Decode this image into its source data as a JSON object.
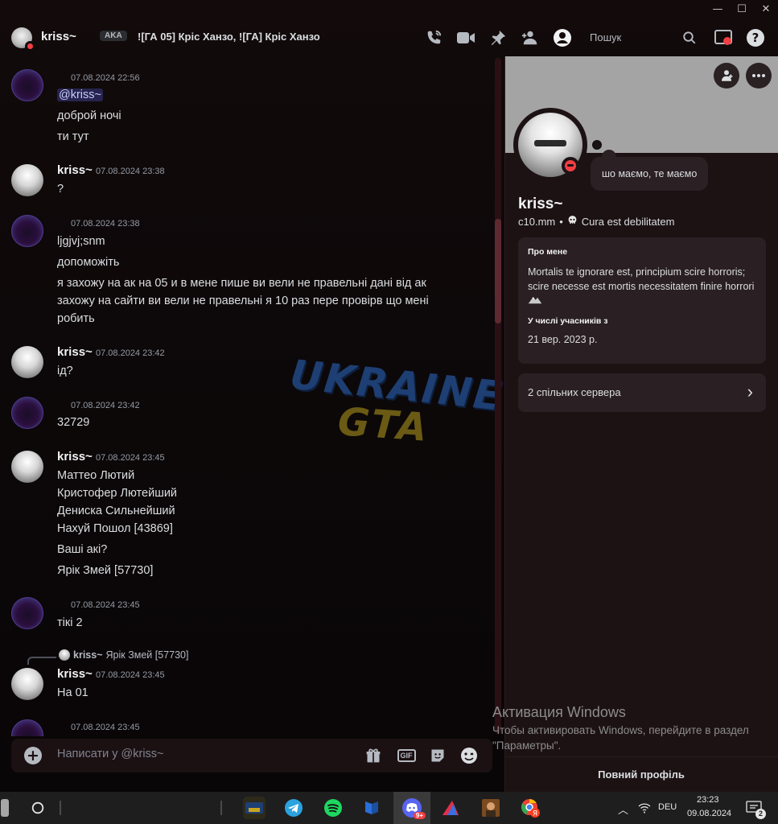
{
  "window": {
    "minimize": "—",
    "maximize": "☐",
    "close": "✕"
  },
  "header": {
    "name": "kriss~",
    "aka_label": "AKA",
    "nicknames": "![ГА 05] Кріс Ханзо, ![ГА] Кріс Ханзо",
    "search_placeholder": "Пошук"
  },
  "messages": [
    {
      "author": "",
      "time": "07.08.2024 22:56",
      "lines": [
        "@kriss~",
        "доброй ночі",
        "ти тут"
      ]
    },
    {
      "author": "kriss~",
      "time": "07.08.2024 23:38",
      "lines": [
        "?"
      ]
    },
    {
      "author": "",
      "time": "07.08.2024 23:38",
      "lines": [
        "ljgjvj;snm",
        "допоможіть",
        "я захожу на ак на 05 и в мене пише ви вели не правельні дані від ак",
        "захожу на сайти ви вели не правельні  я 10 раз пере провірв  що мені",
        "робить"
      ]
    },
    {
      "author": "kriss~",
      "time": "07.08.2024 23:42",
      "lines": [
        "ід?"
      ]
    },
    {
      "author": "",
      "time": "07.08.2024 23:42",
      "lines": [
        "32729"
      ]
    },
    {
      "author": "kriss~",
      "time": "07.08.2024 23:45",
      "lines": [
        "Маттео Лютий",
        "Кристофер Лютейший",
        "Дениска Сильнейший",
        "Нахуй Пошол [43869]",
        "Ваші акі?",
        "Ярік Змей [57730]"
      ]
    },
    {
      "author": "",
      "time": "07.08.2024 23:45",
      "lines": [
        "тікі 2"
      ]
    },
    {
      "author": "kriss~",
      "time": "07.08.2024 23:45",
      "lines": [
        "На 01"
      ],
      "reply_author": "kriss~",
      "reply_text": "Ярік Змей [57730]"
    },
    {
      "author": "",
      "time": "07.08.2024 23:45",
      "lines": []
    }
  ],
  "watermark": {
    "line1": "UKRAINE",
    "line2": "GTA"
  },
  "composer": {
    "placeholder": "Написати у @kriss~"
  },
  "profile": {
    "status_bubble": "шо маємо, те маємо",
    "display_name": "kriss~",
    "username": "c10.mm",
    "separator": "•",
    "custom_status": "Cura est debilitatem",
    "about_title": "Про мене",
    "about_text": "Mortalis te ignorare est, principium scire horroris; scire necesse est mortis necessitatem finire horrori",
    "member_since_title": "У числі учасників з",
    "member_since": "21 вер. 2023 р.",
    "mutual_servers": "2 спільних сервера",
    "full_profile": "Повний профіль"
  },
  "activation": {
    "title": "Активация Windows",
    "text": "Чтобы активировать Windows, перейдите в раздел \"Параметры\"."
  },
  "taskbar": {
    "lang": "DEU",
    "time": "23:23",
    "date": "09.08.2024",
    "discord_badge": "9+",
    "notif_count": "2"
  },
  "colors": {
    "dnd": "#f23f43",
    "mention_bg": "#3a3e7a",
    "banner": "#a5a4a4"
  }
}
